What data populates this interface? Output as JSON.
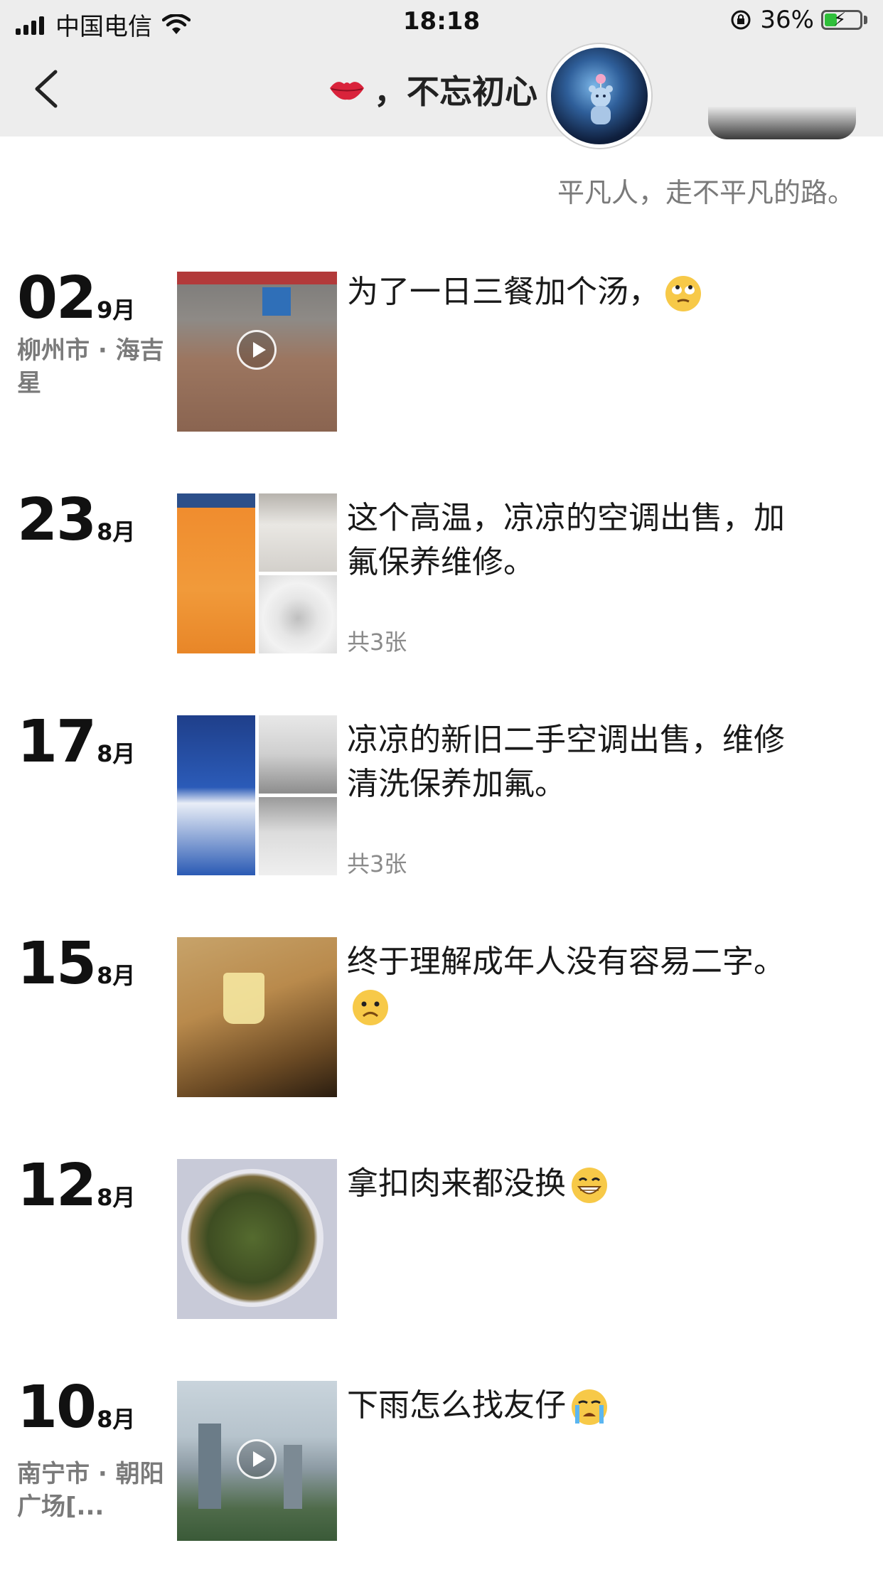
{
  "status_bar": {
    "carrier": "中国电信",
    "time": "18:18",
    "battery": "36%",
    "battery_level": 0.36
  },
  "nav": {
    "title": "，不忘初心",
    "back_icon": "chevron-left-icon",
    "title_emoji": "kiss-lips-icon"
  },
  "signature": "平凡人，走不平凡的路。",
  "entries": [
    {
      "day": "02",
      "month": "9月",
      "location": "柳州市 · 海吉星",
      "text": "为了一日三餐加个汤，",
      "emoji": "rolling-eyes-emoji",
      "media": "video",
      "count": ""
    },
    {
      "day": "23",
      "month": "8月",
      "location": "",
      "text": "这个高温，凉凉的空调出售，加氟保养维修。",
      "emoji": "",
      "media": "images",
      "count": "共3张"
    },
    {
      "day": "17",
      "month": "8月",
      "location": "",
      "text": "凉凉的新旧二手空调出售，维修清洗保养加氟。",
      "emoji": "",
      "media": "images",
      "count": "共3张"
    },
    {
      "day": "15",
      "month": "8月",
      "location": "",
      "text": "终于理解成年人没有容易二字。",
      "emoji": "frowning-face-emoji",
      "media": "image",
      "count": ""
    },
    {
      "day": "12",
      "month": "8月",
      "location": "",
      "text": "拿扣肉来都没换",
      "emoji": "grinning-face-emoji",
      "media": "image",
      "count": ""
    },
    {
      "day": "10",
      "month": "8月",
      "location": "南宁市 · 朝阳广场[...",
      "text": "下雨怎么找友仔",
      "emoji": "crying-face-emoji",
      "media": "video",
      "count": ""
    }
  ],
  "colors": {
    "header_bg": "#ededed",
    "muted_text": "#7a7a7a",
    "battery_green": "#2fbf3a"
  }
}
